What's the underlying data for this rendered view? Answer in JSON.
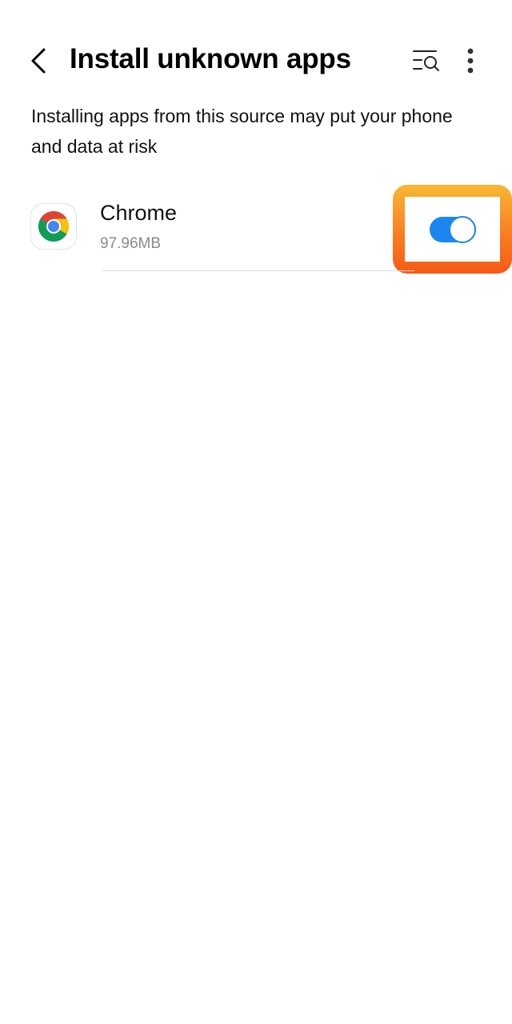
{
  "header": {
    "title": "Install unknown apps",
    "back_icon": "chevron-left-icon",
    "search_icon": "list-search-icon",
    "more_icon": "more-vertical-icon"
  },
  "description": "Installing apps from this source may put your phone and data at risk",
  "apps": [
    {
      "name": "Chrome",
      "size": "97.96MB",
      "icon": "chrome-icon",
      "allowed": true
    }
  ],
  "colors": {
    "toggle_on": "#1a86f0",
    "highlight_top": "#f9b733",
    "highlight_bottom": "#f65a17",
    "secondary_text": "#8a8a8a"
  }
}
